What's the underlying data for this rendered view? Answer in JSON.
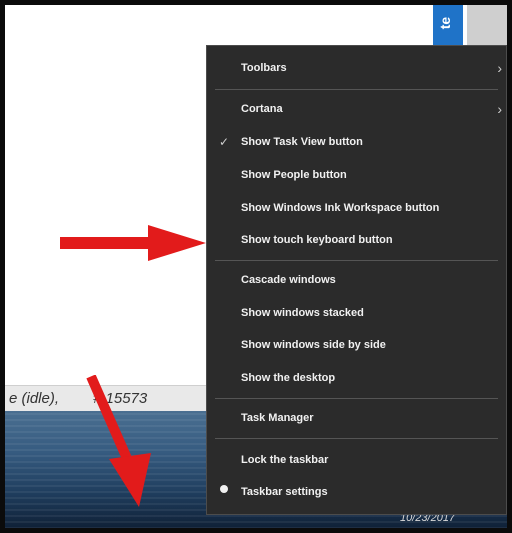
{
  "background": {
    "tile_text": "te",
    "status_text": "e (idle),",
    "status_hash": "# 15573",
    "taskbar_date": "10/23/2017"
  },
  "menu": {
    "items": [
      {
        "label": "Toolbars",
        "submenu": true
      },
      {
        "label": "Cortana",
        "submenu": true
      },
      {
        "label": "Show Task View button",
        "checked": true
      },
      {
        "label": "Show People button"
      },
      {
        "label": "Show Windows Ink Workspace button"
      },
      {
        "label": "Show touch keyboard button"
      },
      {
        "label": "Cascade windows"
      },
      {
        "label": "Show windows stacked"
      },
      {
        "label": "Show windows side by side"
      },
      {
        "label": "Show the desktop"
      },
      {
        "label": "Task Manager"
      },
      {
        "label": "Lock the taskbar"
      },
      {
        "label": "Taskbar settings",
        "selected": true
      }
    ]
  },
  "colors": {
    "menu_bg": "#2b2b2b",
    "menu_text": "#f1f1f1",
    "arrow": "#e21b1b",
    "tile_blue": "#1f73c8"
  },
  "icons": [
    "chevron-right-icon",
    "check-icon",
    "radio-dot-icon",
    "red-arrow-icon"
  ]
}
